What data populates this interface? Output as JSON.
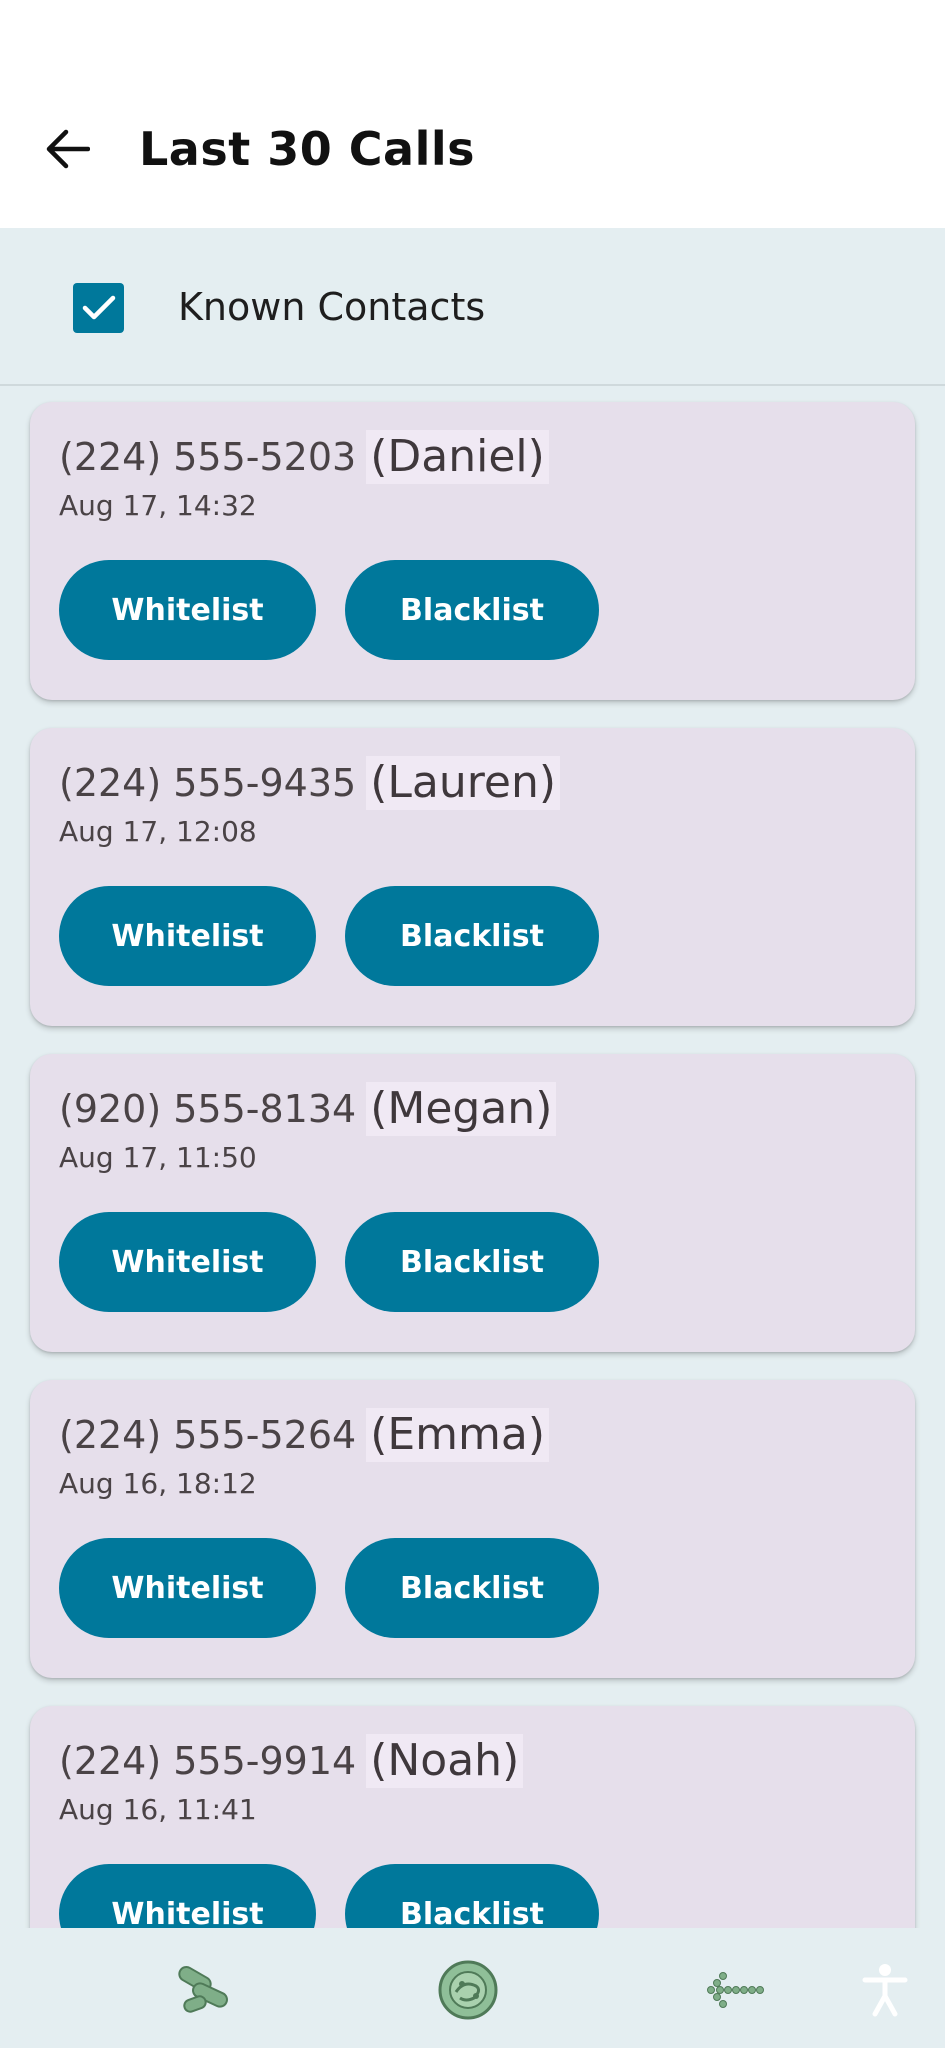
{
  "header": {
    "title": "Last 30 Calls",
    "back_icon": "arrow-left-icon"
  },
  "filter": {
    "label": "Known Contacts",
    "checked": true
  },
  "colors": {
    "accent": "#00789b",
    "card_bg": "#e6dfeb",
    "screen_bg": "#e4eef1"
  },
  "calls": [
    {
      "phone": "(224) 555-5203",
      "name": "(Daniel)",
      "time": "Aug 17, 14:32",
      "whitelist_label": "Whitelist",
      "blacklist_label": "Blacklist"
    },
    {
      "phone": "(224) 555-9435",
      "name": "(Lauren)",
      "time": "Aug 17, 12:08",
      "whitelist_label": "Whitelist",
      "blacklist_label": "Blacklist"
    },
    {
      "phone": "(920) 555-8134",
      "name": "(Megan)",
      "time": "Aug 17, 11:50",
      "whitelist_label": "Whitelist",
      "blacklist_label": "Blacklist"
    },
    {
      "phone": "(224) 555-5264",
      "name": "(Emma)",
      "time": "Aug 16, 18:12",
      "whitelist_label": "Whitelist",
      "blacklist_label": "Blacklist"
    },
    {
      "phone": "(224) 555-9914",
      "name": "(Noah)",
      "time": "Aug 16, 11:41",
      "whitelist_label": "Whitelist",
      "blacklist_label": "Blacklist"
    }
  ],
  "bottom_nav": {
    "icons": [
      "bacteria-icon",
      "virus-cell-icon",
      "dotted-arrow-left-icon",
      "accessibility-icon"
    ]
  }
}
